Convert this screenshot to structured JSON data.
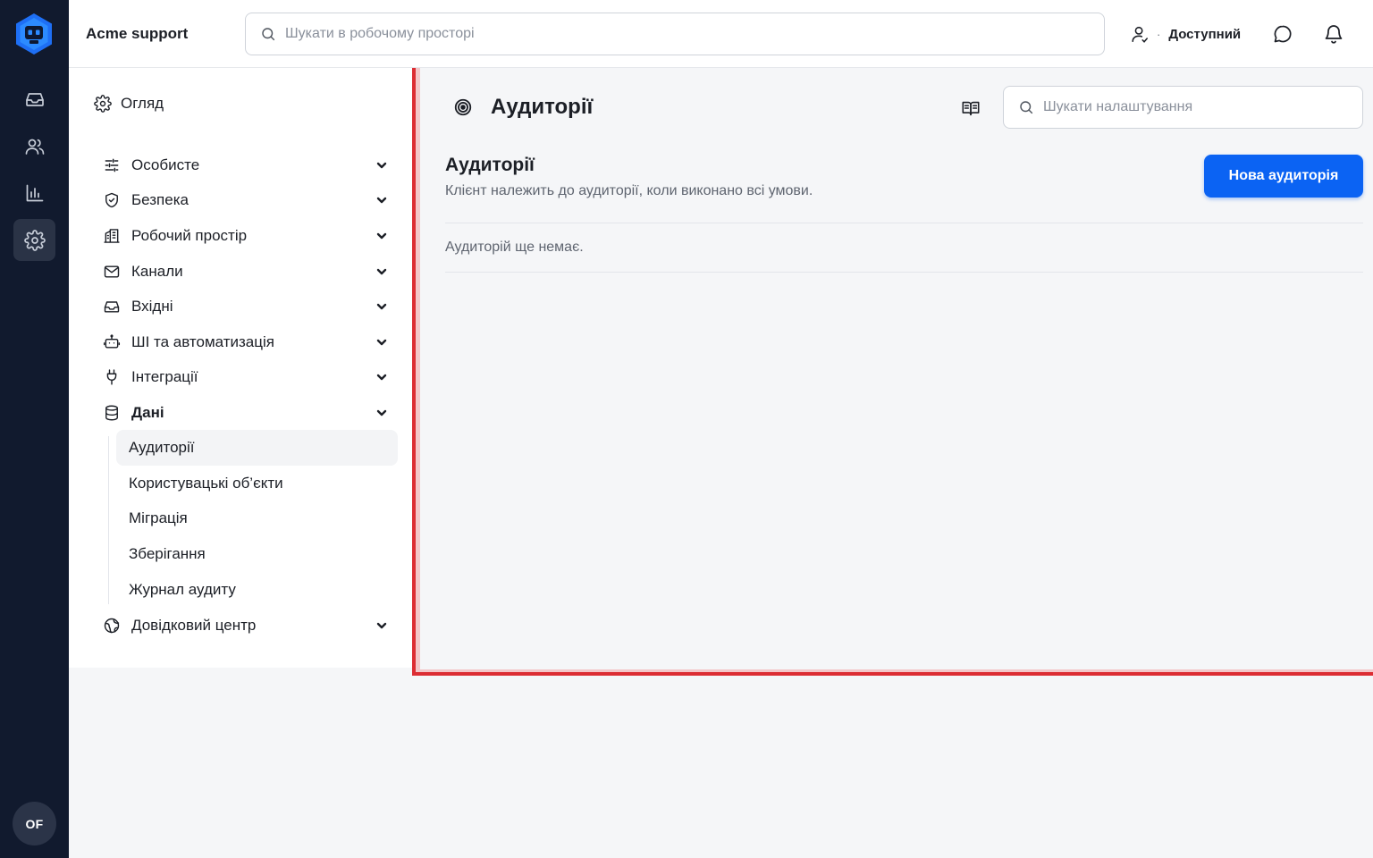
{
  "app": {
    "workspace_name": "Acme support",
    "avatar_initials": "OF",
    "brand_color": "#0b63f3",
    "rail_items": [
      {
        "name": "inbox-icon",
        "active": false
      },
      {
        "name": "contacts-icon",
        "active": false
      },
      {
        "name": "reports-icon",
        "active": false
      },
      {
        "name": "settings-icon",
        "active": true
      }
    ]
  },
  "topbar": {
    "search_placeholder": "Шукати в робочому просторі",
    "status_label": "Доступний",
    "status_dot": "·",
    "icons": [
      "user-status-icon",
      "chat-icon",
      "bell-icon"
    ]
  },
  "nav": {
    "overview_label": "Огляд",
    "items": [
      {
        "label": "Особисте",
        "icon": "sliders-icon"
      },
      {
        "label": "Безпека",
        "icon": "shield-icon"
      },
      {
        "label": "Робочий простір",
        "icon": "building-icon"
      },
      {
        "label": "Канали",
        "icon": "mail-icon"
      },
      {
        "label": "Вхідні",
        "icon": "inbox-icon"
      },
      {
        "label": "ШІ та автоматизація",
        "icon": "robot-icon"
      },
      {
        "label": "Інтеграції",
        "icon": "plug-icon"
      },
      {
        "label": "Дані",
        "icon": "database-icon",
        "expanded": true
      },
      {
        "label": "Довідковий центр",
        "icon": "globe-icon"
      }
    ],
    "data_subitems": [
      {
        "label": "Аудиторії",
        "active": true
      },
      {
        "label": "Користувацькі об’єкти"
      },
      {
        "label": "Міграція"
      },
      {
        "label": "Зберігання"
      },
      {
        "label": "Журнал аудиту"
      }
    ]
  },
  "main": {
    "page_title": "Аудиторії",
    "settings_search_placeholder": "Шукати налаштування",
    "section_title": "Аудиторії",
    "section_description": "Клієнт належить до аудиторії, коли виконано всі умови.",
    "new_button_label": "Нова аудиторія",
    "empty_message": "Аудиторій ще немає."
  }
}
